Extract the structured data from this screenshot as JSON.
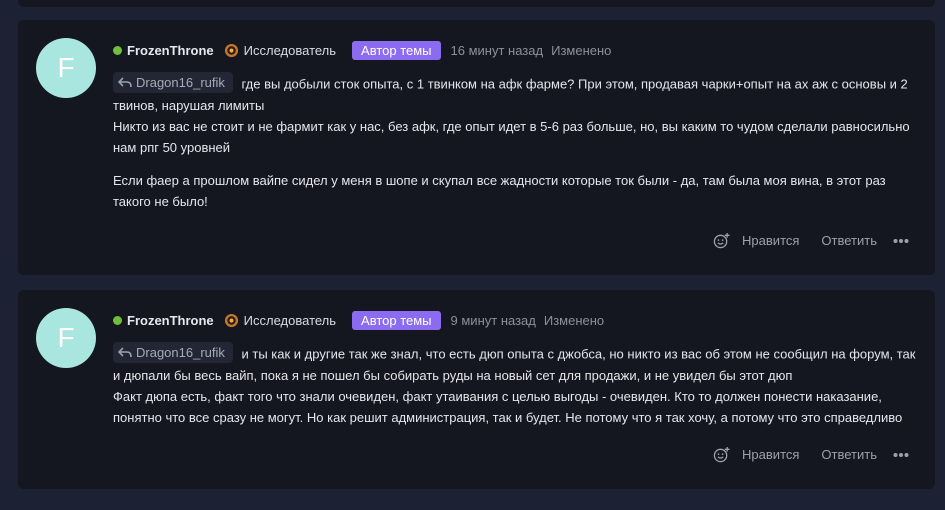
{
  "posts": [
    {
      "avatar_letter": "F",
      "author": "FrozenThrone",
      "rank": "Исследователь",
      "badge": "Автор темы",
      "time": "16 минут назад",
      "edited": "Изменено",
      "quote_user": "Dragon16_rufik",
      "line1": "где вы добыли сток опыта, с 1 твинком на афк фарме? При этом, продавая чарки+опыт на ах аж с основы и 2 твинов, нарушая лимиты",
      "line2": "Никто из вас не стоит и не фармит как у нас, без афк, где опыт идет в 5-6 раз больше, но, вы каким то чудом сделали равносильно нам рпг 50 уровней",
      "para2": "Если фаер а прошлом вайпе сидел у меня в шопе и скупал все жадности которые ток были - да, там была моя вина, в этот раз такого не было!",
      "like": "Нравится",
      "reply": "Ответить"
    },
    {
      "avatar_letter": "F",
      "author": "FrozenThrone",
      "rank": "Исследователь",
      "badge": "Автор темы",
      "time": "9 минут назад",
      "edited": "Изменено",
      "quote_user": "Dragon16_rufik",
      "line1": "и ты как и другие так же знал, что есть дюп опыта с джобса, но никто из вас об этом не сообщил на форум, так и дюпали бы весь вайп, пока я не пошел бы собирать руды на новый сет для продажи, и не увидел бы этот дюп",
      "line2": "Факт дюпа есть, факт того что знали очевиден, факт утаивания с целью выгоды - очевиден. Кто то должен понести наказание, понятно что все сразу не могут. Но как решит администрация, так и будет. Не потому что я так хочу, а потому что это справедливо",
      "like": "Нравится",
      "reply": "Ответить"
    }
  ],
  "colors": {
    "page_bg": "#1c2233",
    "card_bg": "#14171f",
    "badge_bg": "#8b6cf0",
    "online": "#6fbf3b",
    "avatar_bg": "#a8e6df"
  },
  "icons": [
    "online-dot",
    "rank-medal-icon",
    "reply-arrow-icon",
    "add-reaction-icon",
    "more-options-icon"
  ]
}
